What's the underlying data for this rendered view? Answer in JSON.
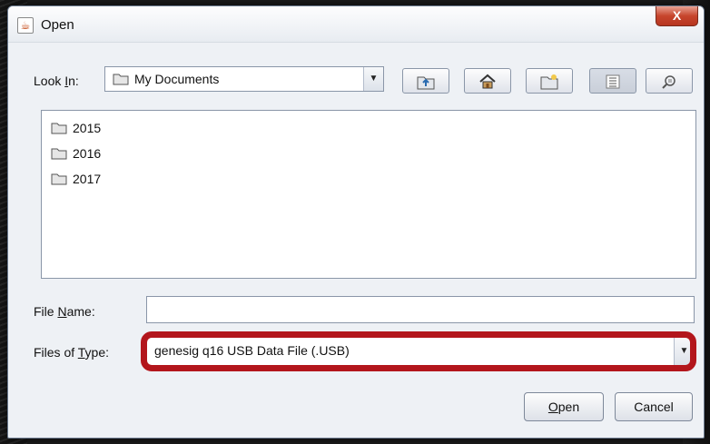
{
  "window": {
    "title": "Open",
    "close_label": "X"
  },
  "look_in": {
    "label_pre": "Look ",
    "label_mnemonic": "I",
    "label_post": "n:",
    "selected": "My Documents"
  },
  "toolbar": {
    "up_icon": "up-folder-icon",
    "home_icon": "home-icon",
    "new_folder_icon": "new-folder-icon",
    "list_view_icon": "list-view-icon",
    "details_view_icon": "details-view-icon"
  },
  "files": [
    {
      "name": "2015"
    },
    {
      "name": "2016"
    },
    {
      "name": "2017"
    }
  ],
  "file_name": {
    "label_pre": "File ",
    "label_mnemonic": "N",
    "label_post": "ame:",
    "value": ""
  },
  "file_type": {
    "label_pre": "Files of ",
    "label_mnemonic": "T",
    "label_post": "ype:",
    "selected": "genesig q16 USB Data File (.USB)"
  },
  "buttons": {
    "open_mnemonic": "O",
    "open_rest": "pen",
    "cancel": "Cancel"
  },
  "colors": {
    "highlight": "#b3161c",
    "close_button": "#c7452d"
  }
}
